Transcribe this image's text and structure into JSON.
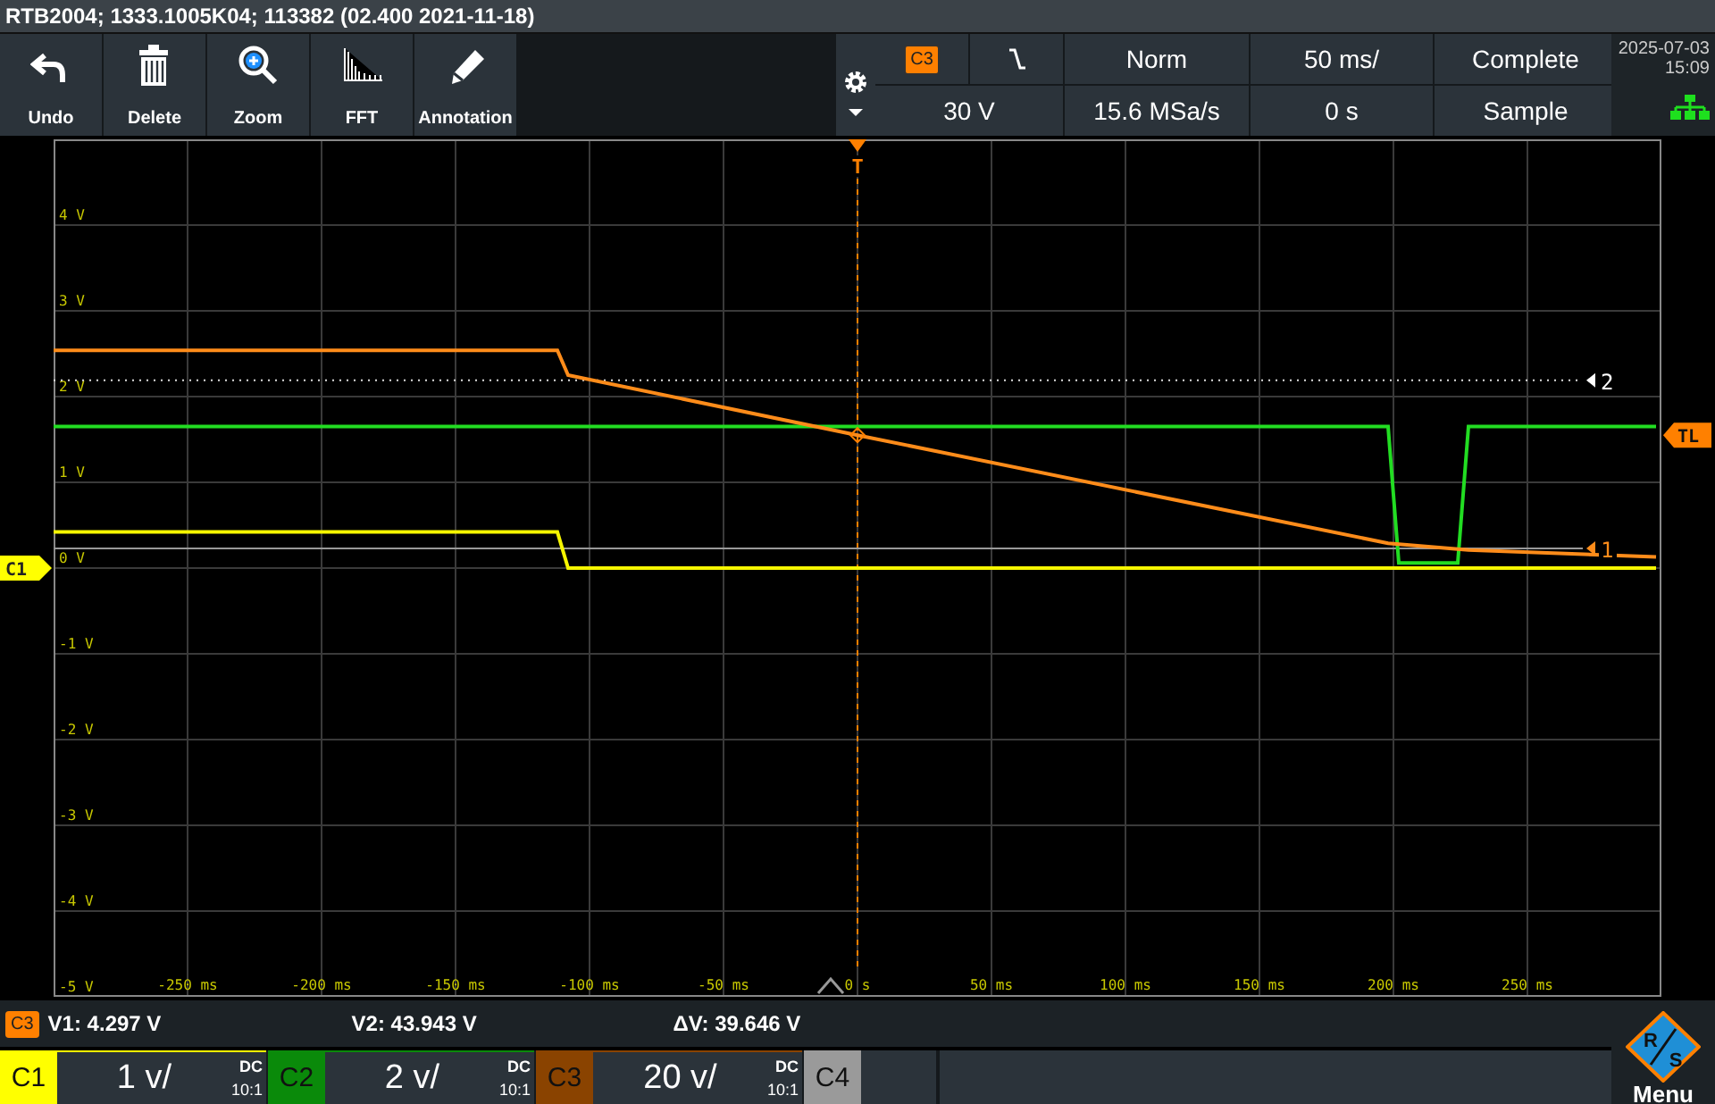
{
  "title": "RTB2004; 1333.1005K04; 113382 (02.400 2021-11-18)",
  "toolbar": [
    {
      "kind": "undo",
      "label": "Undo"
    },
    {
      "kind": "delete",
      "label": "Delete"
    },
    {
      "kind": "zoom",
      "label": "Zoom"
    },
    {
      "kind": "fft",
      "label": "FFT"
    },
    {
      "kind": "annotation",
      "label": "Annotation"
    }
  ],
  "settings": {
    "source": "C3",
    "trigger_mode": "Norm",
    "timebase": "50 ms/",
    "acquisition": "Complete",
    "trigger_level": "30 V",
    "sample_rate": "15.6 MSa/s",
    "position": "0 s",
    "acquisition_mode": "Sample"
  },
  "clock": {
    "date": "2025-07-03",
    "time": "15:09"
  },
  "plot": {
    "chart_data": {
      "type": "line",
      "grid": true,
      "xlim": [
        -300,
        300
      ],
      "ylim": [
        -5,
        5
      ],
      "x": [
        -300,
        -112,
        -108,
        0,
        198,
        202,
        224,
        228,
        298
      ],
      "series": [
        {
          "color": "#f5f500",
          "values": [
            0.42,
            0.42,
            0,
            0,
            0,
            0,
            0,
            0,
            0
          ]
        },
        {
          "color": "#22dd22",
          "values": [
            1.65,
            1.65,
            1.65,
            1.65,
            1.65,
            0.06,
            0.06,
            1.65,
            1.65
          ]
        },
        {
          "color": "#ff8c1a",
          "values": [
            2.54,
            2.54,
            2.25,
            1.55,
            0.29,
            0.28,
            0.22,
            0.21,
            0.13
          ]
        }
      ],
      "xticks": [
        {
          "value": -250,
          "label": "-250 ms"
        },
        {
          "value": -200,
          "label": "-200 ms"
        },
        {
          "value": -150,
          "label": "-150 ms"
        },
        {
          "value": -100,
          "label": "-100 ms"
        },
        {
          "value": -50,
          "label": "-50 ms"
        },
        {
          "value": 0,
          "label": "0 s"
        },
        {
          "value": 50,
          "label": "50 ms"
        },
        {
          "value": 100,
          "label": "100 ms"
        },
        {
          "value": 150,
          "label": "150 ms"
        },
        {
          "value": 200,
          "label": "200 ms"
        },
        {
          "value": 250,
          "label": "250 ms"
        }
      ],
      "yticks": [
        {
          "value": 4,
          "label": "4 V"
        },
        {
          "value": 3,
          "label": "3 V"
        },
        {
          "value": 2,
          "label": "2 V"
        },
        {
          "value": 1,
          "label": "1 V"
        },
        {
          "value": 0,
          "label": "0 V"
        },
        {
          "value": -1,
          "label": "-1 V"
        },
        {
          "value": -2,
          "label": "-2 V"
        },
        {
          "value": -3,
          "label": "-3 V"
        },
        {
          "value": -4,
          "label": "-4 V"
        },
        {
          "value": -5,
          "label": "-5 V"
        }
      ],
      "ref_lines": [
        {
          "axis": "x",
          "value": 0,
          "label": "T"
        },
        {
          "axis": "y",
          "value": 2.19
        },
        {
          "axis": "y",
          "value": 0.23
        }
      ]
    },
    "cursors": [
      {
        "label": "2"
      },
      {
        "label": "1"
      }
    ],
    "markers": [
      {
        "kind": "trigger_level",
        "label": "TL"
      },
      {
        "kind": "channel",
        "label": "C1"
      }
    ]
  },
  "measurement": {
    "source": "C3",
    "values": [
      "V1: 4.297 V",
      "V2: 43.943 V",
      "ΔV: 39.646 V"
    ]
  },
  "channels": [
    {
      "label": "C1",
      "color": "#ffff00",
      "scale": "1 v/",
      "coupling": "DC",
      "probe": "10:1"
    },
    {
      "label": "C2",
      "color": "#0a8a0a",
      "scale": "2 v/",
      "coupling": "DC",
      "probe": "10:1"
    },
    {
      "label": "C3",
      "color": "#8a4300",
      "scale": "20 v/",
      "coupling": "DC",
      "probe": "10:1"
    },
    {
      "label": "C4",
      "color": "#9a9a9a"
    }
  ],
  "menu": {
    "label": "Menu",
    "logo": [
      "R",
      "S"
    ]
  }
}
